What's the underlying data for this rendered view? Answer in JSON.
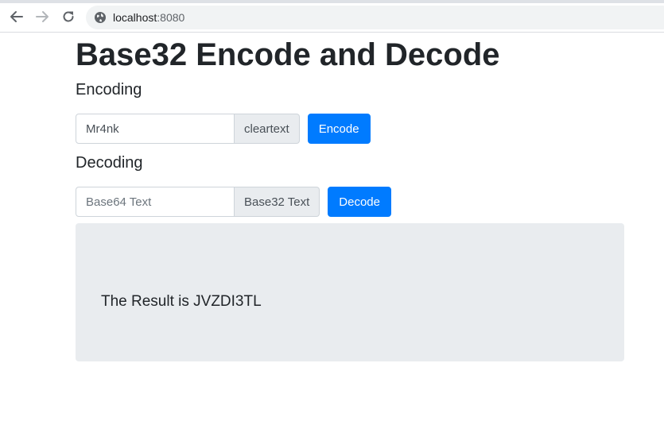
{
  "browser": {
    "url_host": "localhost",
    "url_port": ":8080"
  },
  "page": {
    "title": "Base32 Encode and Decode",
    "encoding": {
      "heading": "Encoding",
      "input_value": "Mr4nk",
      "input_placeholder": "",
      "addon_label": "cleartext",
      "button_label": "Encode"
    },
    "decoding": {
      "heading": "Decoding",
      "input_value": "",
      "input_placeholder": "Base64 Text",
      "addon_label": "Base32 Text",
      "button_label": "Decode"
    },
    "result": {
      "text": "The Result is JVZDI3TL"
    }
  },
  "colors": {
    "primary": "#007bff",
    "jumbotron_bg": "#e9ecef",
    "addon_bg": "#e9ecef"
  },
  "icons": {
    "back": "arrow-left-icon",
    "forward": "arrow-right-icon",
    "reload": "reload-icon",
    "site": "globe-icon"
  }
}
